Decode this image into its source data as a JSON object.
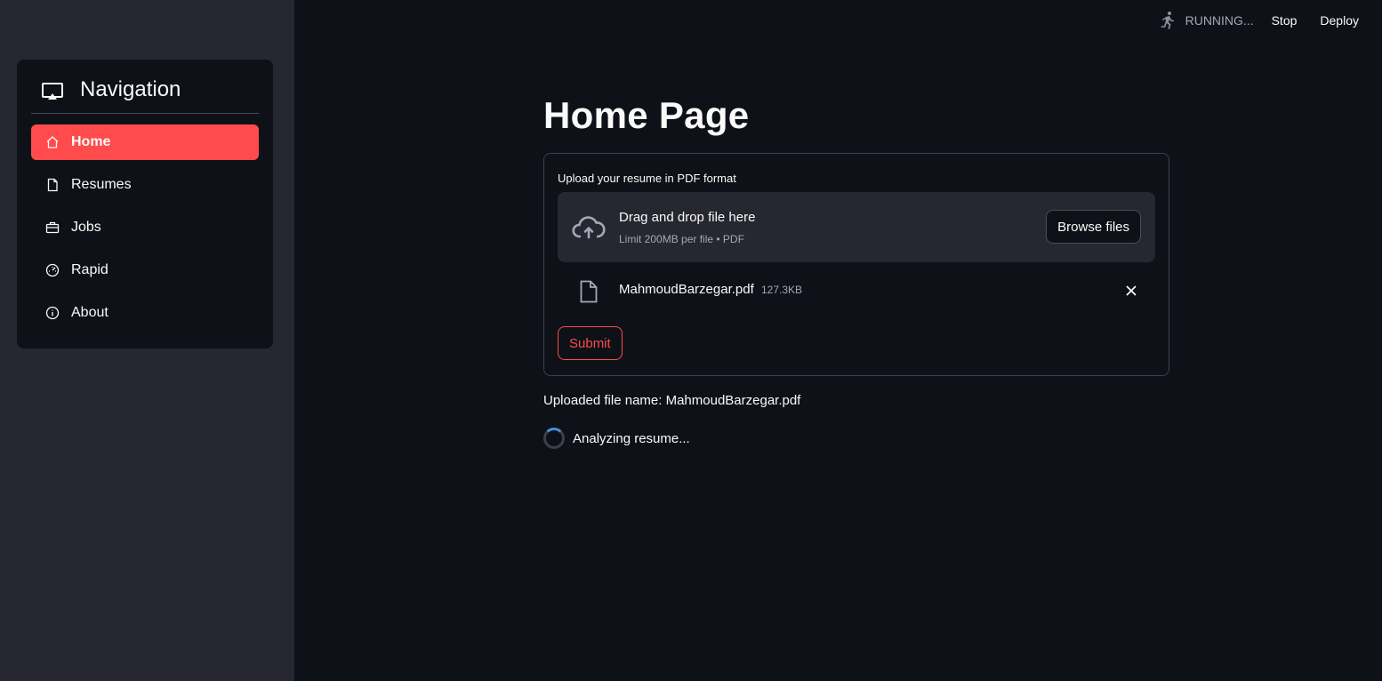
{
  "sidebar": {
    "title": "Navigation",
    "title_icon": "monitor-icon",
    "items": [
      {
        "label": "Home",
        "icon": "home-icon",
        "active": true
      },
      {
        "label": "Resumes",
        "icon": "file-icon",
        "active": false
      },
      {
        "label": "Jobs",
        "icon": "briefcase-icon",
        "active": false
      },
      {
        "label": "Rapid",
        "icon": "speedometer-icon",
        "active": false
      },
      {
        "label": "About",
        "icon": "info-icon",
        "active": false
      }
    ]
  },
  "topbar": {
    "status": "RUNNING...",
    "stop_label": "Stop",
    "deploy_label": "Deploy"
  },
  "main": {
    "title": "Home Page",
    "uploader": {
      "label": "Upload your resume in PDF format",
      "drop_title": "Drag and drop file here",
      "drop_subtitle": "Limit 200MB per file • PDF",
      "browse_label": "Browse files",
      "file": {
        "name": "MahmoudBarzegar.pdf",
        "size": "127.3KB"
      }
    },
    "submit_label": "Submit",
    "uploaded_text": "Uploaded file name: MahmoudBarzegar.pdf",
    "status_text": "Analyzing resume..."
  },
  "colors": {
    "accent": "#ff4b4b",
    "background": "#0e1117",
    "sidebar_bg": "#262730"
  }
}
